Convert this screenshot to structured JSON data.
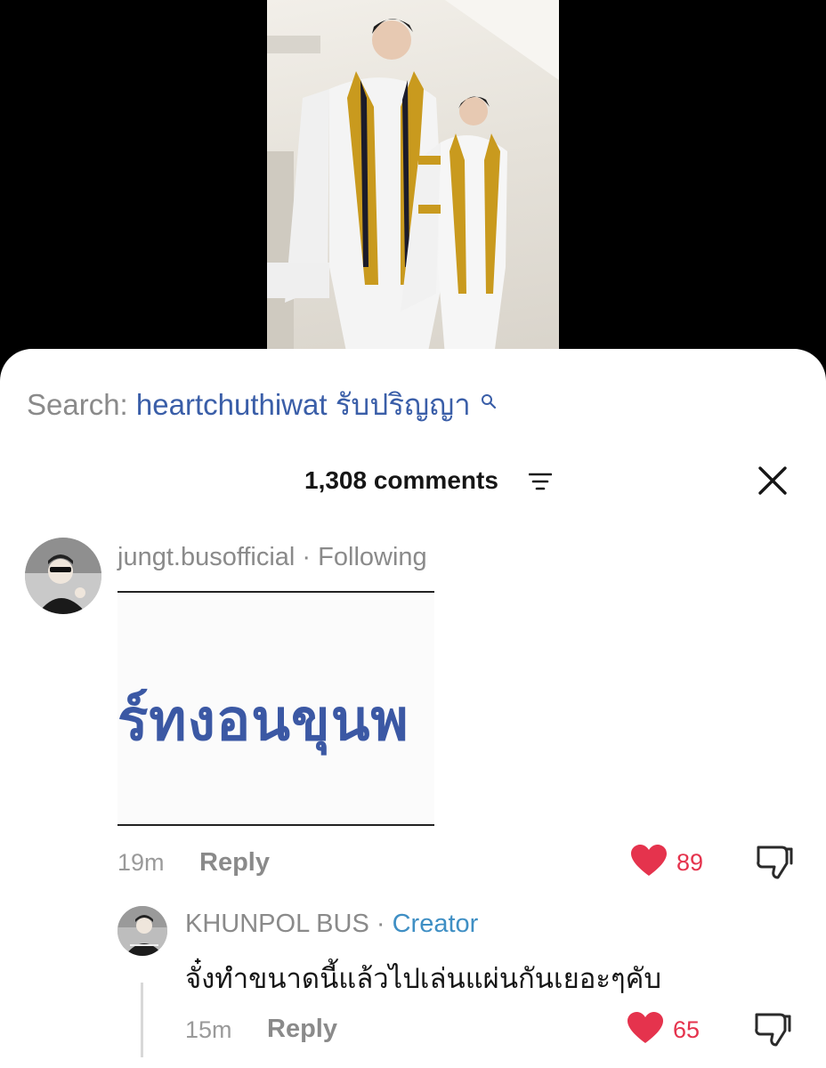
{
  "search": {
    "prefix": "Search:",
    "query": "heartchuthiwat รับปริญญา"
  },
  "header": {
    "comments_count": "1,308 comments"
  },
  "comments": [
    {
      "username": "jungt.busofficial",
      "separator": " · ",
      "relation": "Following",
      "sticker_text": "ร์ทงอนขุนพ",
      "time": "19m",
      "reply_label": "Reply",
      "likes": "89"
    },
    {
      "username": "KHUNPOL BUS",
      "separator": " · ",
      "relation": "Creator",
      "text": "จั๋งทำขนาดนี้แล้วไปเล่นแผ่นกันเยอะๆคับ",
      "time": "15m",
      "reply_label": "Reply",
      "likes": "65"
    }
  ],
  "colors": {
    "like": "#e5334d",
    "creator": "#3f8fc4",
    "search_query": "#3a5ea8"
  },
  "icons": [
    "search-icon",
    "sort-icon",
    "close-icon",
    "heart-icon",
    "dislike-icon"
  ]
}
